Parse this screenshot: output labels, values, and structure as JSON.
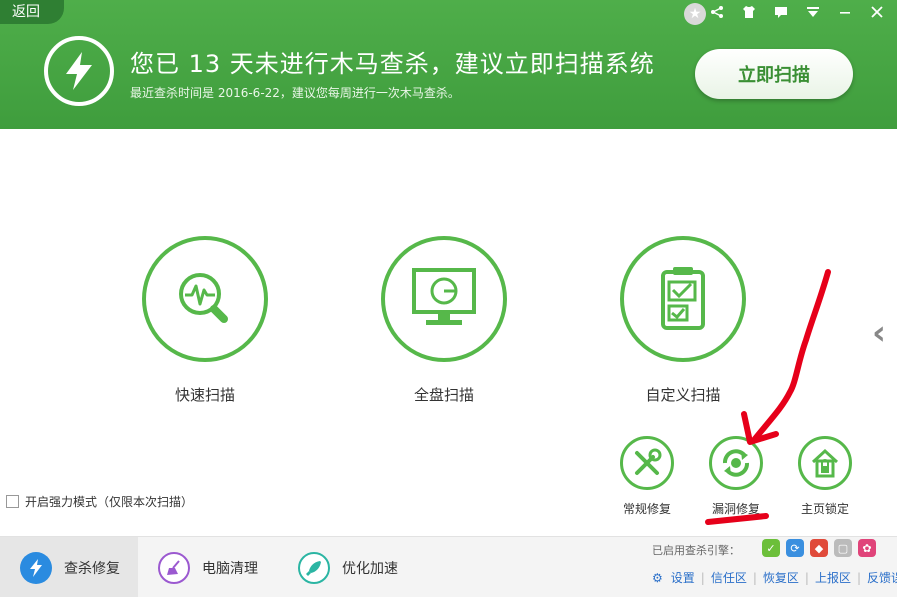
{
  "header": {
    "back_label": "返回",
    "headline": "您已 13 天未进行木马查杀，建议立即扫描系统",
    "subline": "最近查杀时间是 2016-6-22，建议您每周进行一次木马查杀。",
    "scan_now_label": "立即扫描"
  },
  "scan_options": [
    {
      "label": "快速扫描",
      "icon": "magnifier-pulse-icon"
    },
    {
      "label": "全盘扫描",
      "icon": "monitor-icon"
    },
    {
      "label": "自定义扫描",
      "icon": "checklist-icon"
    }
  ],
  "tools": [
    {
      "label": "常规修复",
      "icon": "wrench-screwdriver-icon"
    },
    {
      "label": "漏洞修复",
      "icon": "refresh-shield-icon"
    },
    {
      "label": "主页锁定",
      "icon": "house-lock-icon"
    }
  ],
  "strong_mode_label": "开启强力模式（仅限本次扫描）",
  "bottom_tabs": [
    {
      "label": "查杀修复",
      "color": "#2a8be0"
    },
    {
      "label": "电脑清理",
      "color": "#9b59d0"
    },
    {
      "label": "优化加速",
      "color": "#2bb5a3"
    }
  ],
  "engine_label": "已启用查杀引擎：",
  "links": {
    "settings": "设置",
    "trust": "信任区",
    "restore": "恢复区",
    "report": "上报区",
    "feedback": "反馈误报"
  },
  "colors": {
    "brand_green": "#4fae4a",
    "ring_green": "#56b84a",
    "link_blue": "#2a6fc9"
  }
}
